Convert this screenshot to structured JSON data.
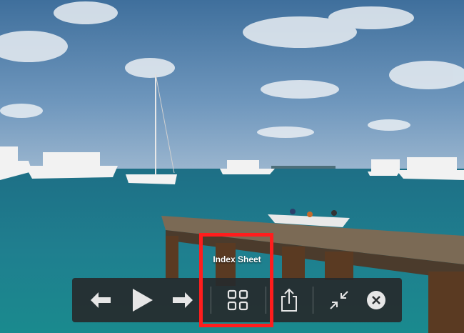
{
  "viewer": {
    "image_description_name": "marina-photo",
    "tooltip": "Index Sheet"
  },
  "toolbar": {
    "buttons": [
      {
        "name": "previous",
        "icon": "arrow-left-icon"
      },
      {
        "name": "play",
        "icon": "play-icon"
      },
      {
        "name": "next",
        "icon": "arrow-right-icon"
      },
      {
        "name": "index-sheet",
        "icon": "grid-icon"
      },
      {
        "name": "share",
        "icon": "share-icon"
      },
      {
        "name": "exit-full-screen",
        "icon": "collapse-icon"
      },
      {
        "name": "close",
        "icon": "close-circle-icon"
      }
    ]
  },
  "colors": {
    "highlight": "#ff1d1d",
    "toolbar_bg": "#262a2c",
    "icon": "#e6e6e6"
  }
}
